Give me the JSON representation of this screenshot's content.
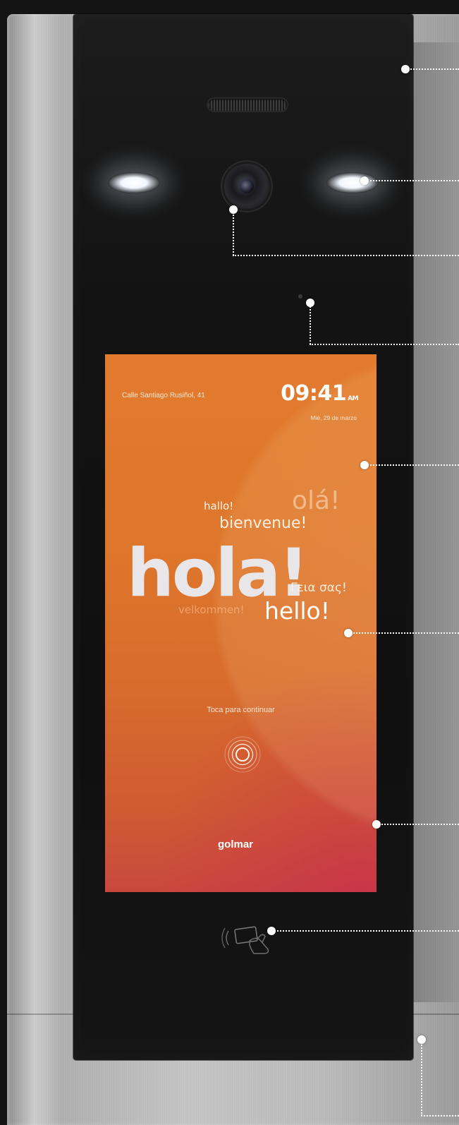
{
  "screen": {
    "address": "Calle Santiago Rusiñol, 41",
    "time": "09:41",
    "time_period": "AM",
    "date": "Mié, 29 de marzo",
    "greetings": {
      "hallo": "hallo!",
      "ola": "olá!",
      "bienvenue": "bienvenue!",
      "hola": "hola!",
      "geia": "Γεια σας!",
      "velkommen": "velkommen!",
      "hello": "hello!"
    },
    "touch_prompt": "Toca para continuar",
    "touch_icon": "touch-ripple-icon",
    "brand": "golmar",
    "colors": {
      "background_top": "#e27b2e",
      "background_bottom": "#c9483e"
    }
  },
  "panel": {
    "frame_brand": "golmar",
    "nfc_icon": "contactless-card-icon"
  }
}
